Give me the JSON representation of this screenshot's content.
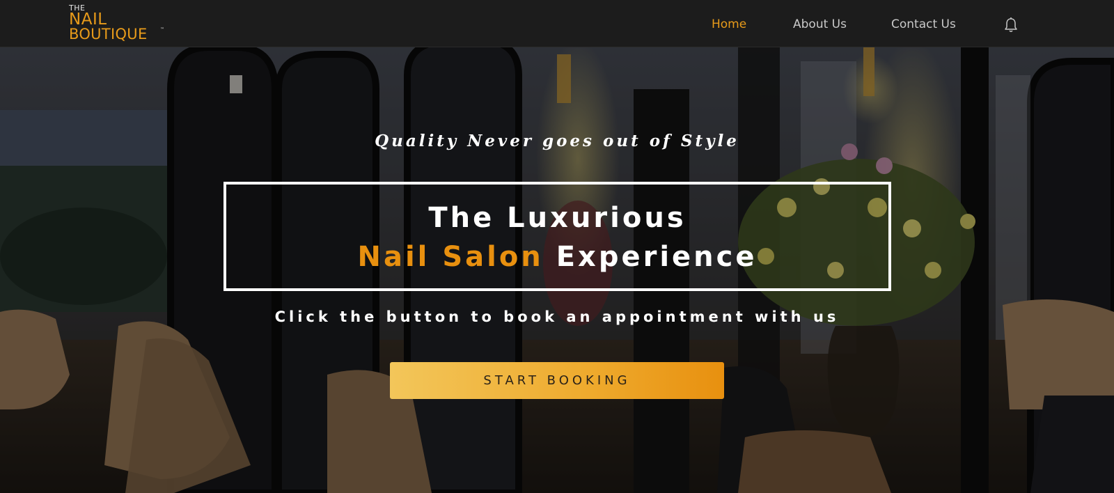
{
  "header": {
    "logo": {
      "the": "THE",
      "nail": "NAIL",
      "boutique": "BOUTIQUE",
      "tm": "™"
    },
    "nav": [
      {
        "label": "Home",
        "active": true
      },
      {
        "label": "About Us",
        "active": false
      },
      {
        "label": "Contact Us",
        "active": false
      }
    ],
    "icons": {
      "notification": "bell-icon"
    }
  },
  "hero": {
    "tagline": "Quality Never goes out of Style",
    "headline_line1": "The Luxurious",
    "headline_line2_accent": "Nail Salon",
    "headline_line2_rest": " Experience",
    "subtext": "Click the button to book an appointment with us",
    "cta_label": "START BOOKING",
    "background": "salon interior photo with mirrors, chairs and lily flowers"
  },
  "colors": {
    "accent": "#e89b1a",
    "header_bg": "#1c1c1c",
    "cta_gradient_start": "#f3c65a",
    "cta_gradient_end": "#e8900f"
  }
}
